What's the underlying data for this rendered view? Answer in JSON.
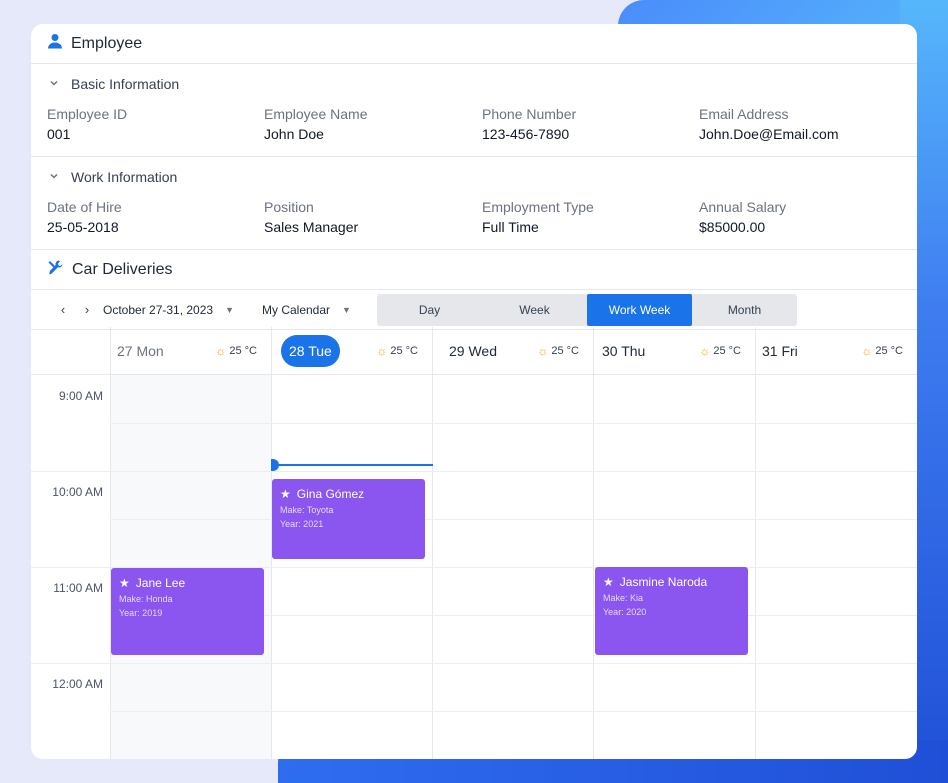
{
  "employee": {
    "title": "Employee",
    "basic": {
      "heading": "Basic Information",
      "fields": [
        {
          "label": "Employee ID",
          "value": "001"
        },
        {
          "label": "Employee Name",
          "value": "John Doe"
        },
        {
          "label": "Phone Number",
          "value": "123-456-7890"
        },
        {
          "label": "Email Address",
          "value": "John.Doe@Email.com"
        }
      ]
    },
    "work": {
      "heading": "Work Information",
      "fields": [
        {
          "label": "Date of Hire",
          "value": "25-05-2018"
        },
        {
          "label": "Position",
          "value": "Sales Manager"
        },
        {
          "label": "Employment Type",
          "value": "Full Time"
        },
        {
          "label": "Annual Salary",
          "value": "$85000.00"
        }
      ]
    }
  },
  "calendar": {
    "title": "Car Deliveries",
    "date_range": "October 27-31, 2023",
    "calendar_select": "My Calendar",
    "views": [
      "Day",
      "Week",
      "Work Week",
      "Month"
    ],
    "active_view": "Work Week",
    "days": [
      {
        "label": "27 Mon",
        "temp": "25 °C"
      },
      {
        "label": "28 Tue",
        "temp": "25 °C"
      },
      {
        "label": "29 Wed",
        "temp": "25 °C"
      },
      {
        "label": "30 Thu",
        "temp": "25 °C"
      },
      {
        "label": "31 Fri",
        "temp": "25 °C"
      }
    ],
    "times": [
      "9:00 AM",
      "10:00 AM",
      "11:00 AM",
      "12:00 AM"
    ],
    "events": [
      {
        "title": "Gina Gómez",
        "make": "Make: Toyota",
        "year": "Year: 2021"
      },
      {
        "title": "Jane Lee",
        "make": "Make: Honda",
        "year": "Year: 2019"
      },
      {
        "title": "Jasmine Naroda",
        "make": "Make: Kia",
        "year": "Year: 2020"
      }
    ]
  },
  "colors": {
    "accent": "#1a73e8",
    "event": "#8b55ef"
  }
}
